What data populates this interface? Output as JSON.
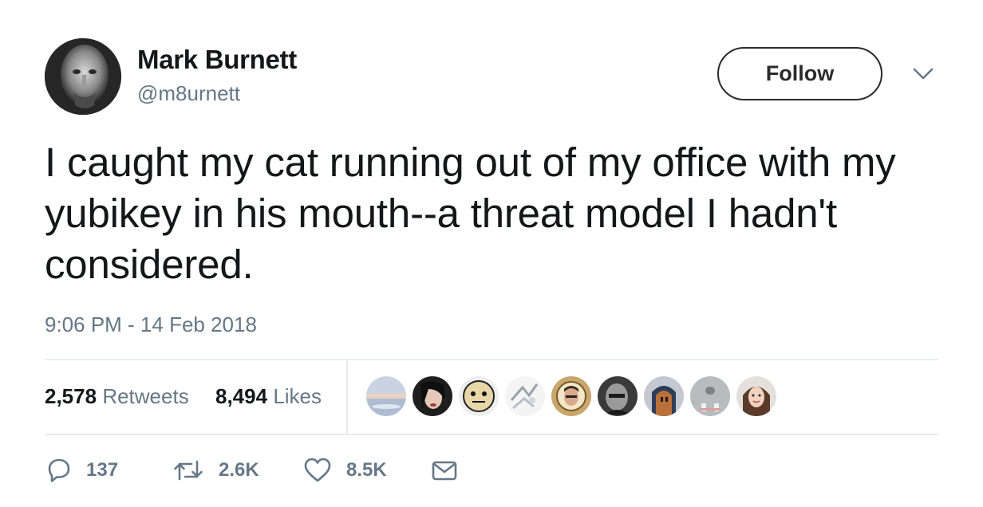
{
  "author": {
    "display_name": "Mark Burnett",
    "handle": "@m8urnett"
  },
  "follow_button": {
    "label": "Follow"
  },
  "tweet": {
    "text": "I caught my cat running out of my office with my yubikey in his mouth--a threat model I hadn't considered.",
    "timestamp": "9:06 PM - 14 Feb 2018"
  },
  "stats": {
    "retweets_count": "2,578",
    "retweets_label": "Retweets",
    "likes_count": "8,494",
    "likes_label": "Likes"
  },
  "likers_count_shown": 9,
  "actions": {
    "reply_count": "137",
    "retweet_count": "2.6K",
    "like_count": "8.5K"
  },
  "icons": {
    "reply": "reply-icon",
    "retweet": "retweet-icon",
    "like": "heart-icon",
    "dm": "envelope-icon",
    "more": "chevron-down-icon"
  },
  "colors": {
    "text": "#14171a",
    "secondary": "#657786",
    "divider": "#e6ecf0",
    "button_border": "#2b2b2b"
  }
}
